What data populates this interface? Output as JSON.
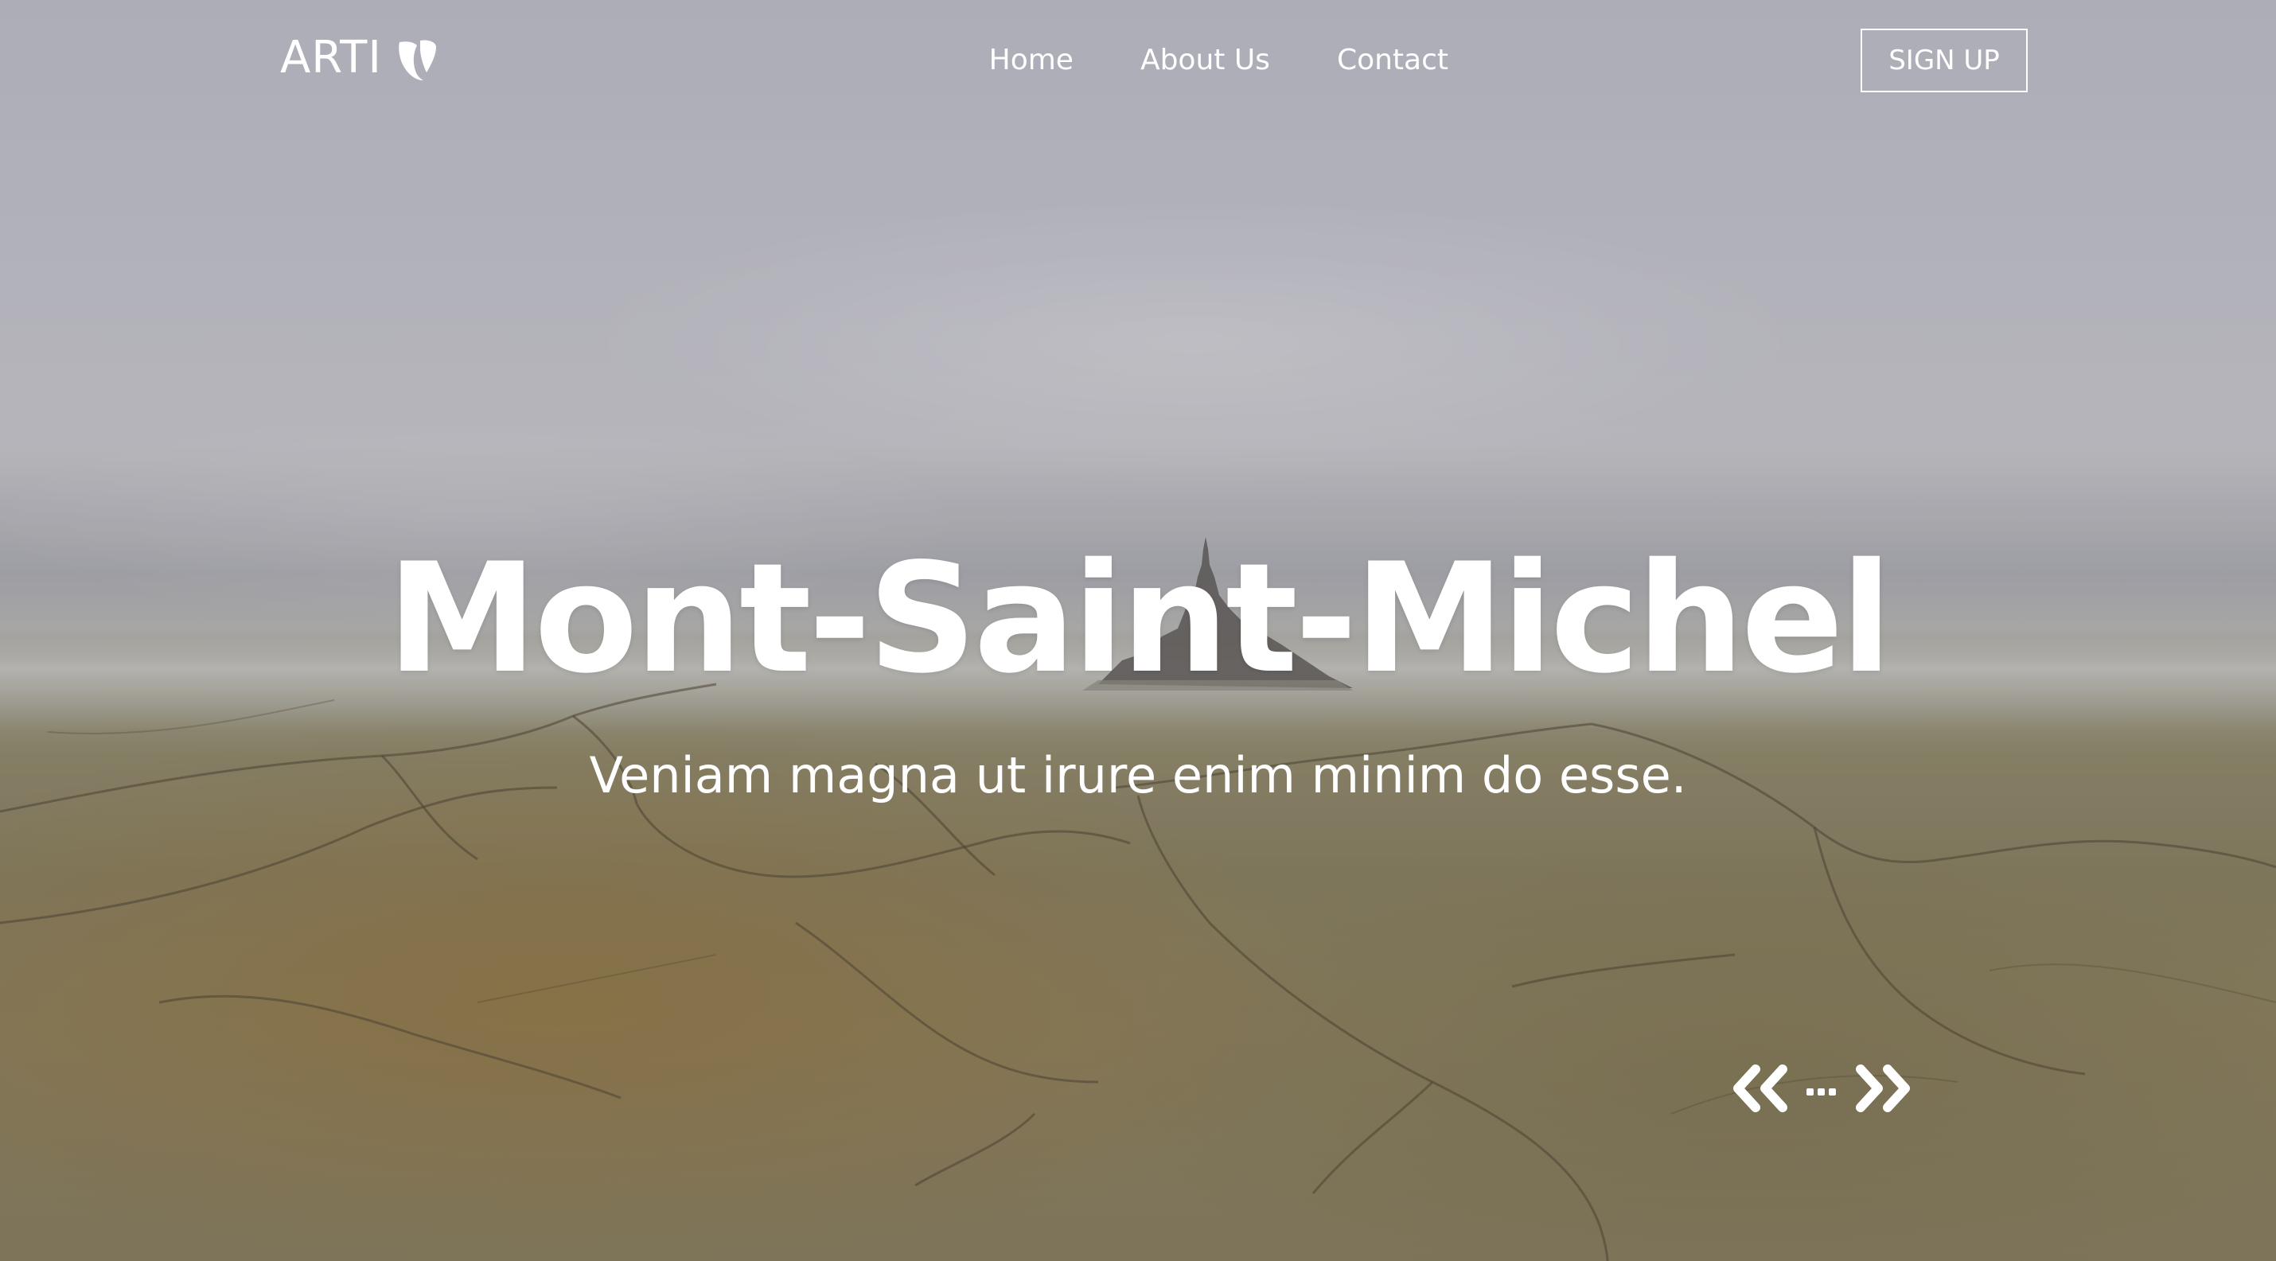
{
  "brand": {
    "name": "ARTI",
    "logo_icon": "typo3-icon"
  },
  "nav": {
    "items": [
      {
        "label": "Home"
      },
      {
        "label": "About Us"
      },
      {
        "label": "Contact"
      }
    ],
    "signup_label": "SIGN UP"
  },
  "hero": {
    "title": "Mont-Saint-Michel",
    "subtitle": "Veniam magna ut irure enim minim do esse.",
    "background": "aerial-photo-mont-saint-michel"
  },
  "slider": {
    "prev_icon": "double-chevron-left-icon",
    "dots_icon": "ellipsis-icon",
    "next_icon": "double-chevron-right-icon"
  },
  "colors": {
    "text": "#ffffff",
    "sky": "#bdbdc6",
    "ground": "#867d5f"
  }
}
